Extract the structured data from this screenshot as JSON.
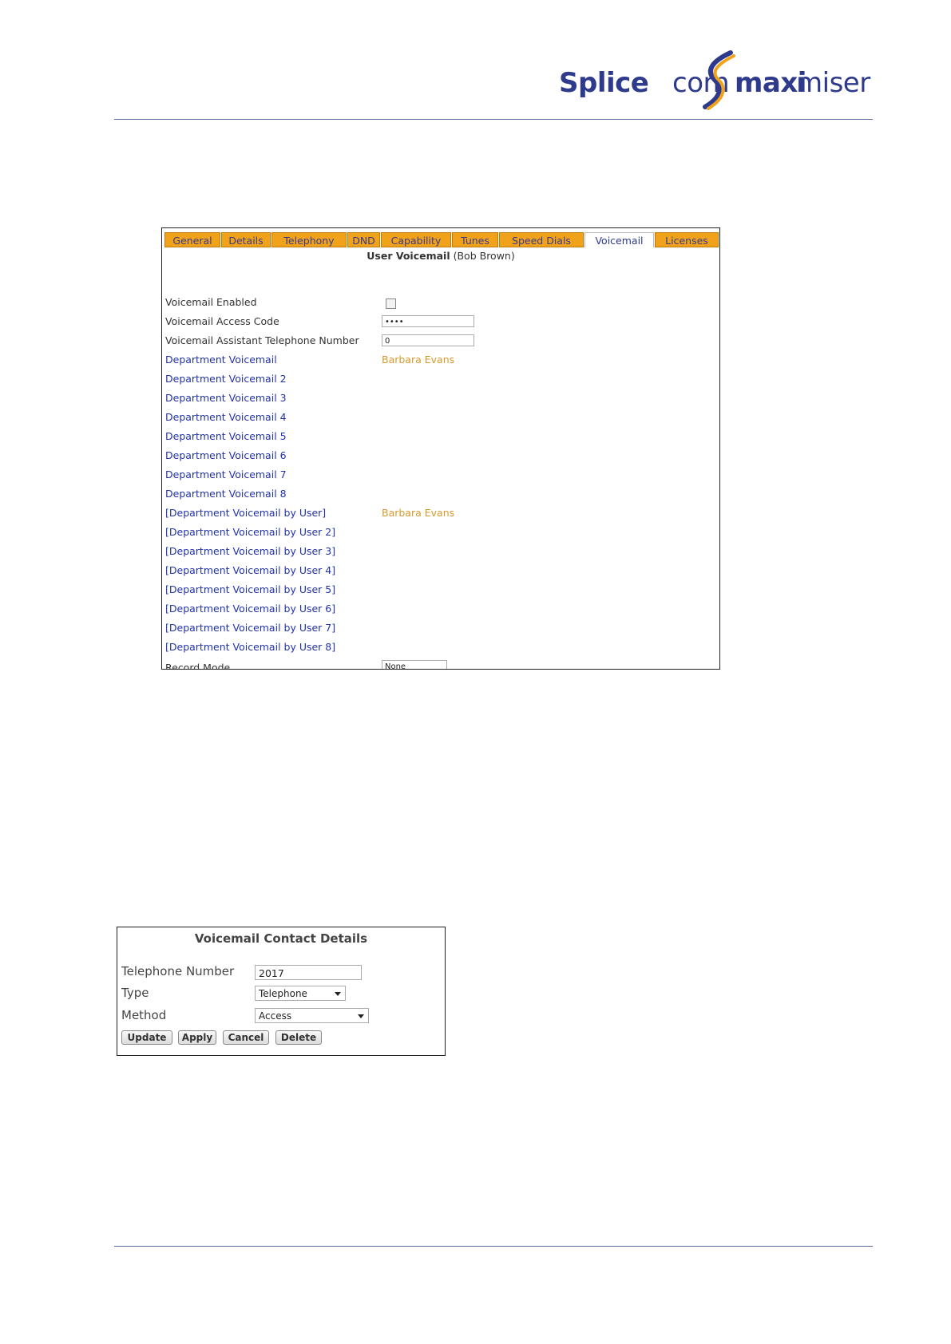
{
  "logo": {
    "brand1a": "Splice",
    "brand1b": "com",
    "brand2a": "maxi",
    "brand2b": "miser"
  },
  "tabs": [
    {
      "label": "General"
    },
    {
      "label": "Details"
    },
    {
      "label": "Telephony"
    },
    {
      "label": "DND"
    },
    {
      "label": "Capability"
    },
    {
      "label": "Tunes"
    },
    {
      "label": "Speed Dials"
    },
    {
      "label": "Voicemail"
    },
    {
      "label": "Licenses"
    }
  ],
  "user_voicemail": {
    "title": "User Voicemail",
    "user": "(Bob Brown)",
    "fields": {
      "enabled_label": "Voicemail Enabled",
      "access_code_label": "Voicemail Access Code",
      "access_code_value": "••••",
      "assistant_label": "Voicemail Assistant Telephone Number",
      "assistant_value": "0",
      "record_mode_label": "Record Mode",
      "record_mode_value": "None"
    },
    "departments": [
      {
        "label": "Department Voicemail",
        "value": "Barbara Evans"
      },
      {
        "label": "Department Voicemail 2",
        "value": ""
      },
      {
        "label": "Department Voicemail 3",
        "value": ""
      },
      {
        "label": "Department Voicemail 4",
        "value": ""
      },
      {
        "label": "Department Voicemail 5",
        "value": ""
      },
      {
        "label": "Department Voicemail 6",
        "value": ""
      },
      {
        "label": "Department Voicemail 7",
        "value": ""
      },
      {
        "label": "Department Voicemail 8",
        "value": ""
      },
      {
        "label": "[Department Voicemail by User]",
        "value": "Barbara Evans"
      },
      {
        "label": "[Department Voicemail by User 2]",
        "value": ""
      },
      {
        "label": "[Department Voicemail by User 3]",
        "value": ""
      },
      {
        "label": "[Department Voicemail by User 4]",
        "value": ""
      },
      {
        "label": "[Department Voicemail by User 5]",
        "value": ""
      },
      {
        "label": "[Department Voicemail by User 6]",
        "value": ""
      },
      {
        "label": "[Department Voicemail by User 7]",
        "value": ""
      },
      {
        "label": "[Department Voicemail by User 8]",
        "value": ""
      }
    ]
  },
  "contact_details": {
    "title": "Voicemail Contact Details",
    "telephone_label": "Telephone Number",
    "telephone_value": "2017",
    "type_label": "Type",
    "type_value": "Telephone",
    "method_label": "Method",
    "method_value": "Access",
    "buttons": {
      "update": "Update",
      "apply": "Apply",
      "cancel": "Cancel",
      "delete": "Delete"
    }
  }
}
